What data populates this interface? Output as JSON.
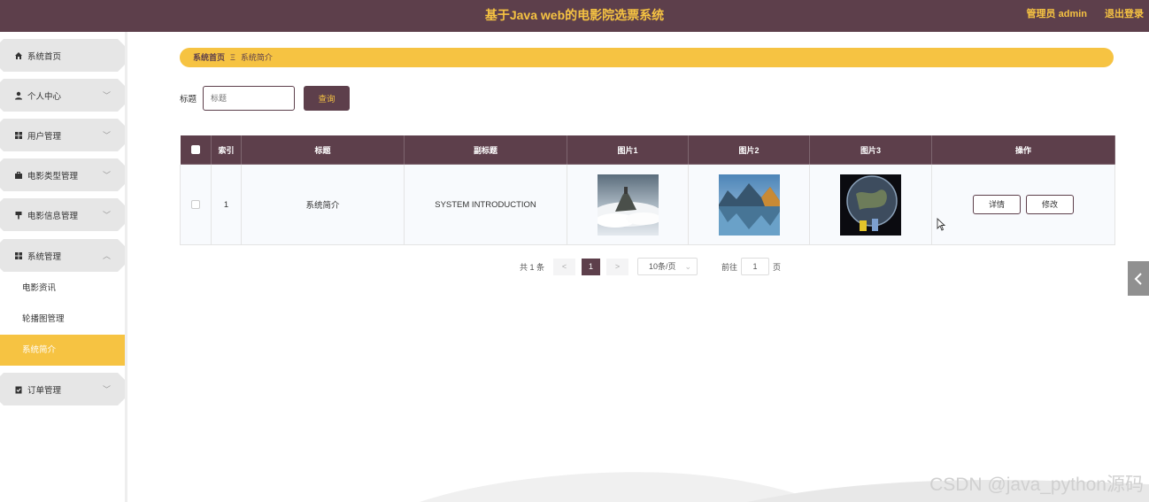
{
  "header": {
    "title": "基于Java web的电影院选票系统",
    "admin_label": "管理员 admin",
    "logout_label": "退出登录"
  },
  "sidebar": {
    "items": [
      {
        "label": "系统首页",
        "icon": "home-icon"
      },
      {
        "label": "个人中心",
        "icon": "user-icon",
        "chevron": "﹀"
      },
      {
        "label": "用户管理",
        "icon": "grid-icon",
        "chevron": "﹀"
      },
      {
        "label": "电影类型管理",
        "icon": "briefcase-icon",
        "chevron": "﹀"
      },
      {
        "label": "电影信息管理",
        "icon": "pin-icon",
        "chevron": "﹀"
      },
      {
        "label": "系统管理",
        "icon": "grid-icon",
        "chevron": "︿"
      },
      {
        "label": "订单管理",
        "icon": "clipboard-icon",
        "chevron": "﹀"
      }
    ],
    "sub_items": [
      {
        "label": "电影资讯"
      },
      {
        "label": "轮播图管理"
      },
      {
        "label": "系统简介",
        "active": true
      }
    ]
  },
  "breadcrumb": {
    "home": "系统首页",
    "separator": "Ξ",
    "current": "系统简介"
  },
  "search": {
    "label": "标题",
    "placeholder": "标题",
    "button_label": "查询"
  },
  "table": {
    "headers": [
      "索引",
      "标题",
      "副标题",
      "图片1",
      "图片2",
      "图片3",
      "操作"
    ],
    "rows": [
      {
        "index": "1",
        "title": "系统简介",
        "subtitle": "SYSTEM INTRODUCTION",
        "image1": "island-castle-clouds-image",
        "image2": "mountain-lake-reflection-image",
        "image3": "earth-planet-figures-image",
        "detail_label": "详情",
        "edit_label": "修改"
      }
    ]
  },
  "pagination": {
    "total": "共 1 条",
    "prev": "<",
    "current_page": "1",
    "next": ">",
    "page_size": "10条/页",
    "goto_label": "前往",
    "goto_value": "1",
    "page_unit": "页"
  },
  "watermark": "CSDN @java_python源码",
  "colors": {
    "primary": "#5d3f4b",
    "accent": "#f6c342"
  }
}
